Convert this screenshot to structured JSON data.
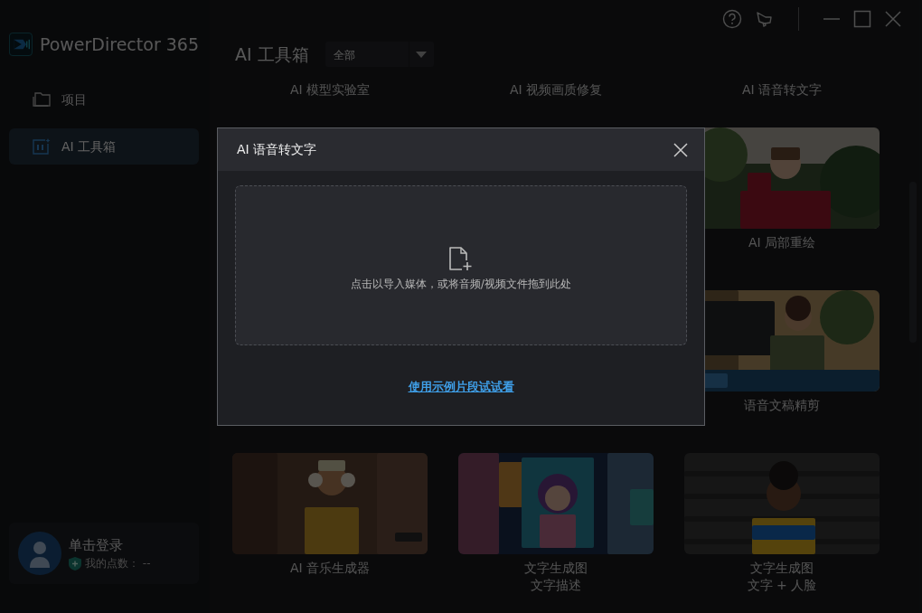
{
  "sidebar": {
    "app_name": "PowerDirector 365",
    "items": [
      {
        "label": "项目",
        "kind": "folder",
        "selected": false
      },
      {
        "label": "AI 工具箱",
        "kind": "ai",
        "selected": true
      }
    ],
    "account": {
      "login": "单击登录",
      "points": "我的点数： --"
    }
  },
  "main": {
    "title": "AI 工具箱",
    "filter": {
      "value": "全部"
    },
    "tool_rows": [
      {
        "cards": [
          {
            "label": "AI 模型实验室"
          },
          {
            "label": "AI 视频画质修复"
          },
          {
            "label": "AI 语音转文字"
          }
        ]
      },
      {
        "cards": [
          {
            "label": "AI 局部重绘"
          }
        ]
      },
      {
        "cards": [
          {
            "label": "语音文稿精剪"
          }
        ]
      },
      {
        "cards": [
          {
            "label": "AI 音乐生成器"
          },
          {
            "label": "文字生成图",
            "sublabel": "文字描述"
          },
          {
            "label": "文字生成图",
            "sublabel": "文字 + 人脸"
          }
        ]
      }
    ]
  },
  "dialog": {
    "title": "AI 语音转文字",
    "drop_hint": "点击以导入媒体，或将音频/视频文件拖到此处",
    "sample_link": "使用示例片段试试看"
  }
}
